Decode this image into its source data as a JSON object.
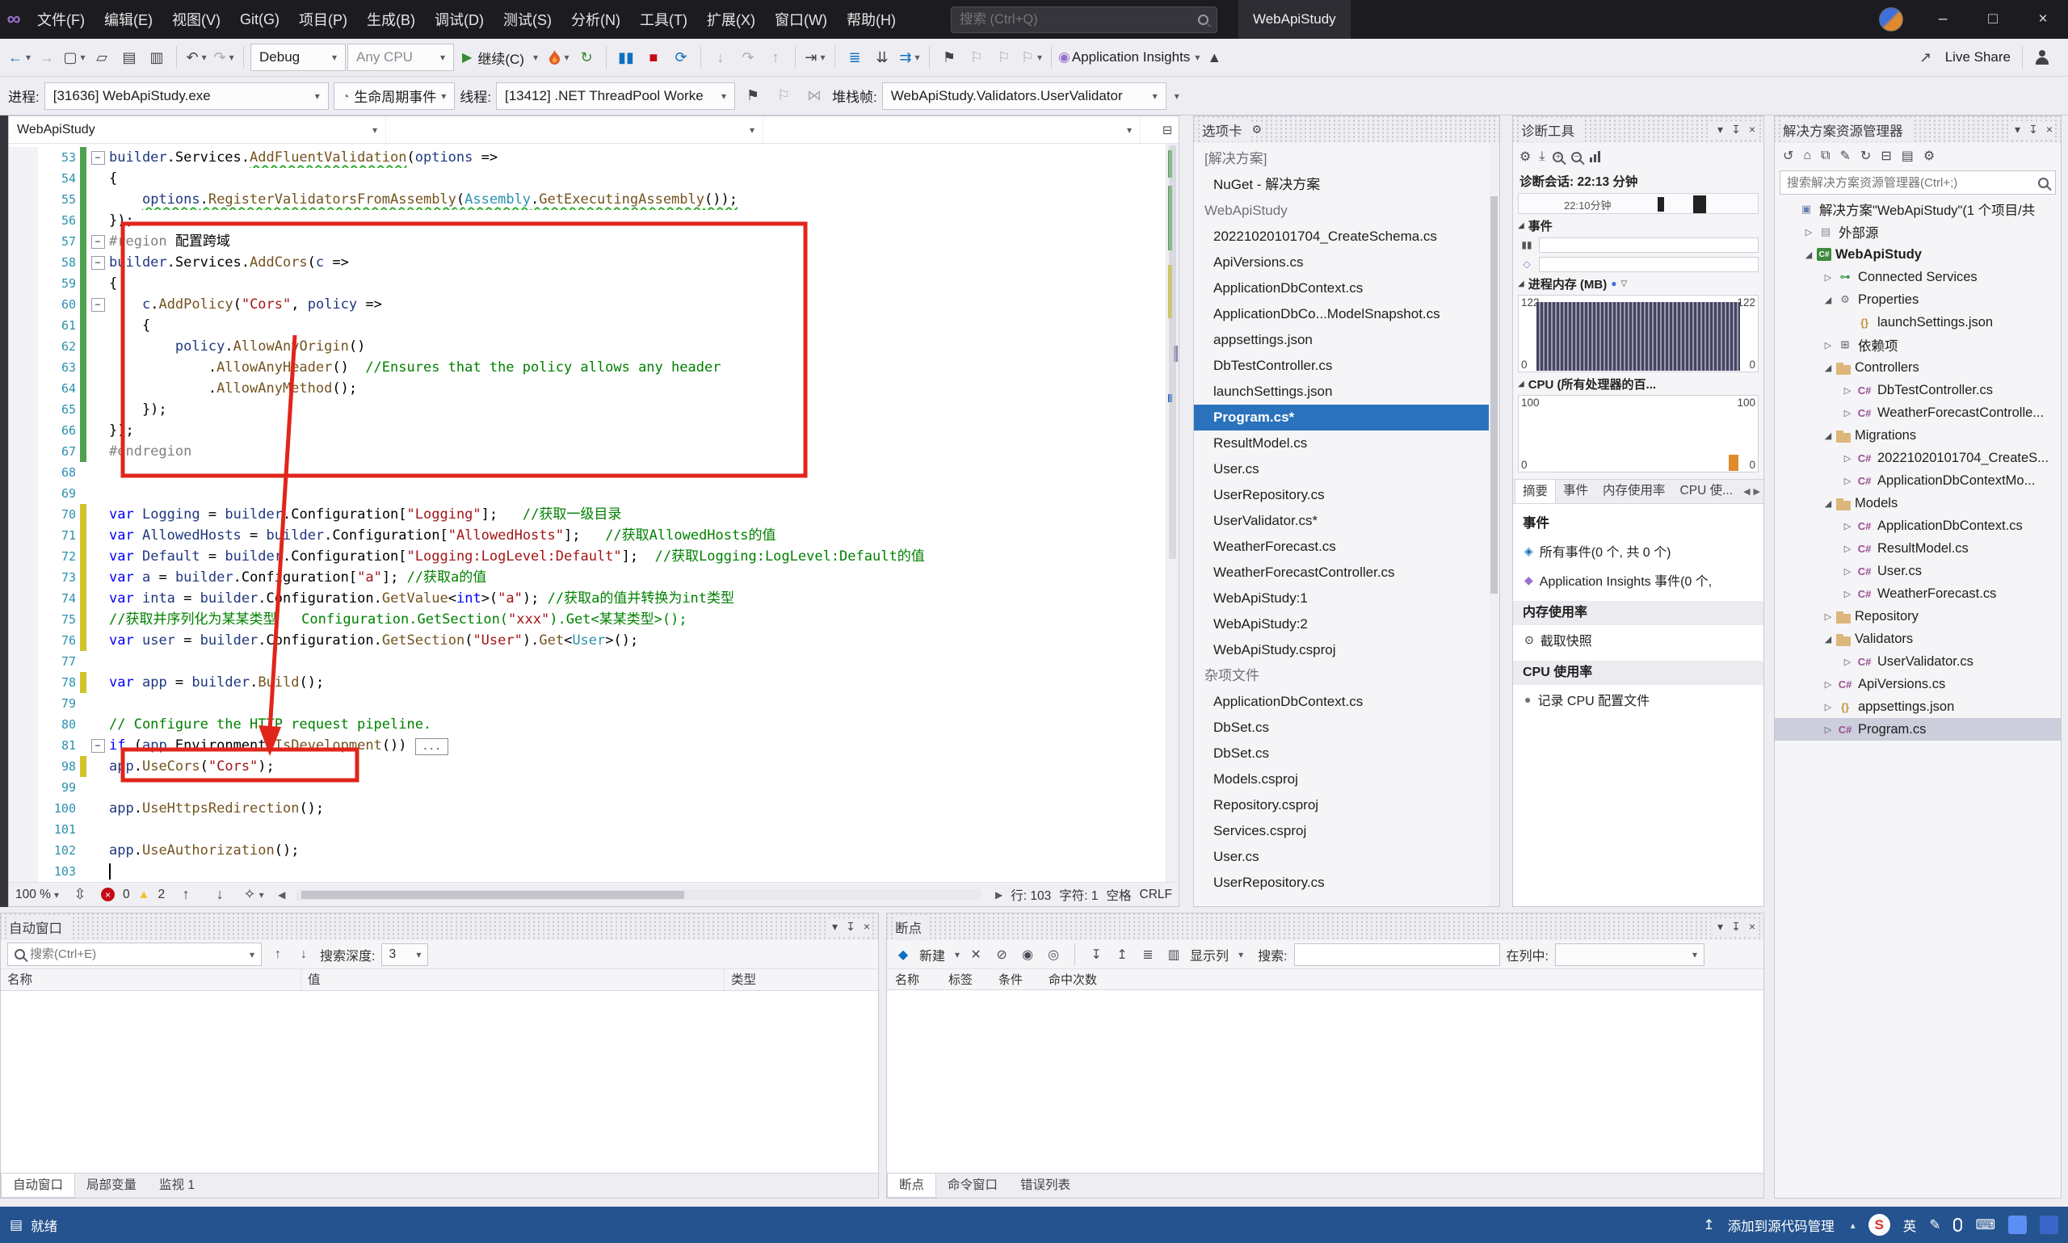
{
  "colors": {
    "accent_blue": "#2b72bd",
    "selection_gray": "#cccedb",
    "annotation_red": "#e1251b",
    "statusbar_blue": "#25538f",
    "error_red": "#c50b17",
    "warning_yellow": "#f2c233",
    "debug_green": "#388a34",
    "keyword_blue": "#0000ff",
    "string_red": "#a31515",
    "comment_green": "#008000",
    "type_teal": "#2b91af"
  },
  "titlebar": {
    "menus": [
      "文件(F)",
      "编辑(E)",
      "视图(V)",
      "Git(G)",
      "项目(P)",
      "生成(B)",
      "调试(D)",
      "测试(S)",
      "分析(N)",
      "工具(T)",
      "扩展(X)",
      "窗口(W)",
      "帮助(H)"
    ],
    "search_placeholder": "搜索 (Ctrl+Q)",
    "solution_name": "WebApiStudy"
  },
  "toolbar": {
    "debug_config": "Debug",
    "platform": "Any CPU",
    "continue_label": "继续(C)",
    "app_insights": "Application Insights",
    "live_share": "Live Share"
  },
  "debugbar": {
    "process_label": "进程:",
    "process": "[31636] WebApiStudy.exe",
    "lifecycle": "生命周期事件",
    "thread_label": "线程:",
    "thread": "[13412] .NET ThreadPool Worke",
    "stack_label": "堆栈帧:",
    "stack": "WebApiStudy.Validators.UserValidator"
  },
  "editor": {
    "breadcrumb": "WebApiStudy",
    "status": {
      "zoom": "100 %",
      "errors": "0",
      "warnings": "2",
      "line": "行: 103",
      "col": "字符: 1",
      "space": "空格",
      "eol": "CRLF"
    },
    "code": [
      {
        "n": 53,
        "fold": true,
        "chg": "g",
        "toks": [
          [
            "l",
            "builder"
          ],
          [
            "p",
            ".Services."
          ],
          [
            "m u",
            "AddFluentValidation"
          ],
          [
            "p",
            "("
          ],
          [
            "l",
            "options"
          ],
          [
            "p",
            " =>"
          ]
        ]
      },
      {
        "n": 54,
        "chg": "g",
        "toks": [
          [
            "p",
            "{"
          ]
        ]
      },
      {
        "n": 55,
        "chg": "g",
        "toks": [
          [
            "p",
            "    "
          ],
          [
            "l u",
            "options"
          ],
          [
            "p u",
            "."
          ],
          [
            "m u",
            "RegisterValidatorsFromAssembly"
          ],
          [
            "p u",
            "("
          ],
          [
            "t u",
            "Assembly"
          ],
          [
            "p u",
            "."
          ],
          [
            "m u",
            "GetExecutingAssembly"
          ],
          [
            "p u",
            "());"
          ]
        ]
      },
      {
        "n": 56,
        "chg": "g",
        "toks": [
          [
            "p",
            "});"
          ]
        ]
      },
      {
        "n": 57,
        "fold": true,
        "chg": "g",
        "toks": [
          [
            "pp",
            "#region"
          ],
          [
            "p",
            " 配置跨域"
          ]
        ]
      },
      {
        "n": 58,
        "fold": true,
        "chg": "g",
        "toks": [
          [
            "l",
            "builder"
          ],
          [
            "p",
            ".Services."
          ],
          [
            "m",
            "AddCors"
          ],
          [
            "p",
            "("
          ],
          [
            "l",
            "c"
          ],
          [
            "p",
            " =>"
          ]
        ]
      },
      {
        "n": 59,
        "chg": "g",
        "toks": [
          [
            "p",
            "{"
          ]
        ]
      },
      {
        "n": 60,
        "fold": true,
        "chg": "g",
        "toks": [
          [
            "p",
            "    "
          ],
          [
            "l",
            "c"
          ],
          [
            "p",
            "."
          ],
          [
            "m",
            "AddPolicy"
          ],
          [
            "p",
            "("
          ],
          [
            "s",
            "\"Cors\""
          ],
          [
            "p",
            ", "
          ],
          [
            "l",
            "policy"
          ],
          [
            "p",
            " =>"
          ]
        ]
      },
      {
        "n": 61,
        "chg": "g",
        "toks": [
          [
            "p",
            "    {"
          ]
        ]
      },
      {
        "n": 62,
        "chg": "g",
        "toks": [
          [
            "p",
            "        "
          ],
          [
            "l",
            "policy"
          ],
          [
            "p",
            "."
          ],
          [
            "m",
            "AllowAnyOrigin"
          ],
          [
            "p",
            "()"
          ]
        ]
      },
      {
        "n": 63,
        "chg": "g",
        "toks": [
          [
            "p",
            "            ."
          ],
          [
            "m",
            "AllowAnyHeader"
          ],
          [
            "p",
            "()  "
          ],
          [
            "c",
            "//Ensures that the policy allows any header"
          ]
        ]
      },
      {
        "n": 64,
        "chg": "g",
        "toks": [
          [
            "p",
            "            ."
          ],
          [
            "m",
            "AllowAnyMethod"
          ],
          [
            "p",
            "();"
          ]
        ]
      },
      {
        "n": 65,
        "chg": "g",
        "toks": [
          [
            "p",
            "    });"
          ]
        ]
      },
      {
        "n": 66,
        "chg": "g",
        "toks": [
          [
            "p",
            "});"
          ]
        ]
      },
      {
        "n": 67,
        "chg": "g",
        "toks": [
          [
            "pp",
            "#endregion"
          ]
        ]
      },
      {
        "n": 68,
        "toks": []
      },
      {
        "n": 69,
        "toks": []
      },
      {
        "n": 70,
        "chg": "y",
        "toks": [
          [
            "k",
            "var"
          ],
          [
            "p",
            " "
          ],
          [
            "l",
            "Logging"
          ],
          [
            "p",
            " = "
          ],
          [
            "l",
            "builder"
          ],
          [
            "p",
            ".Configuration["
          ],
          [
            "s",
            "\"Logging\""
          ],
          [
            "p",
            "];   "
          ],
          [
            "c",
            "//获取一级目录"
          ]
        ]
      },
      {
        "n": 71,
        "chg": "y",
        "toks": [
          [
            "k",
            "var"
          ],
          [
            "p",
            " "
          ],
          [
            "l",
            "AllowedHosts"
          ],
          [
            "p",
            " = "
          ],
          [
            "l",
            "builder"
          ],
          [
            "p",
            ".Configuration["
          ],
          [
            "s",
            "\"AllowedHosts\""
          ],
          [
            "p",
            "];   "
          ],
          [
            "c",
            "//获取AllowedHosts的值"
          ]
        ]
      },
      {
        "n": 72,
        "chg": "y",
        "toks": [
          [
            "k",
            "var"
          ],
          [
            "p",
            " "
          ],
          [
            "l",
            "Default"
          ],
          [
            "p",
            " = "
          ],
          [
            "l",
            "builder"
          ],
          [
            "p",
            ".Configuration["
          ],
          [
            "s",
            "\"Logging:LogLevel:Default\""
          ],
          [
            "p",
            "];  "
          ],
          [
            "c",
            "//获取Logging:LogLevel:Default的值"
          ]
        ]
      },
      {
        "n": 73,
        "chg": "y",
        "toks": [
          [
            "k",
            "var"
          ],
          [
            "p",
            " "
          ],
          [
            "l",
            "a"
          ],
          [
            "p",
            " = "
          ],
          [
            "l",
            "builder"
          ],
          [
            "p",
            ".Configuration["
          ],
          [
            "s",
            "\"a\""
          ],
          [
            "p",
            "]; "
          ],
          [
            "c",
            "//获取a的值"
          ]
        ]
      },
      {
        "n": 74,
        "chg": "y",
        "toks": [
          [
            "k",
            "var"
          ],
          [
            "p",
            " "
          ],
          [
            "l",
            "inta"
          ],
          [
            "p",
            " = "
          ],
          [
            "l",
            "builder"
          ],
          [
            "p",
            ".Configuration."
          ],
          [
            "m",
            "GetValue"
          ],
          [
            "p",
            "<"
          ],
          [
            "k",
            "int"
          ],
          [
            "p",
            ">("
          ],
          [
            "s",
            "\"a\""
          ],
          [
            "p",
            "); "
          ],
          [
            "c",
            "//获取a的值并转换为int类型"
          ]
        ]
      },
      {
        "n": 75,
        "chg": "y",
        "toks": [
          [
            "c",
            "//获取并序列化为某某类型   Configuration.GetSection("
          ],
          [
            "s",
            "\"xxx\""
          ],
          [
            "c",
            ").Get<某某类型>();"
          ]
        ]
      },
      {
        "n": 76,
        "chg": "y",
        "toks": [
          [
            "k",
            "var"
          ],
          [
            "p",
            " "
          ],
          [
            "l",
            "user"
          ],
          [
            "p",
            " = "
          ],
          [
            "l",
            "builder"
          ],
          [
            "p",
            ".Configuration."
          ],
          [
            "m",
            "GetSection"
          ],
          [
            "p",
            "("
          ],
          [
            "s",
            "\"User\""
          ],
          [
            "p",
            ")."
          ],
          [
            "m",
            "Get"
          ],
          [
            "p",
            "<"
          ],
          [
            "t",
            "User"
          ],
          [
            "p",
            ">();"
          ]
        ]
      },
      {
        "n": 77,
        "toks": []
      },
      {
        "n": 78,
        "chg": "y",
        "toks": [
          [
            "k",
            "var"
          ],
          [
            "p",
            " "
          ],
          [
            "l",
            "app"
          ],
          [
            "p",
            " = "
          ],
          [
            "l",
            "builder"
          ],
          [
            "p",
            "."
          ],
          [
            "m",
            "Build"
          ],
          [
            "p",
            "();"
          ]
        ]
      },
      {
        "n": 79,
        "toks": []
      },
      {
        "n": 80,
        "toks": [
          [
            "c",
            "// Configure the HTTP request pipeline."
          ]
        ]
      },
      {
        "n": 81,
        "fold": true,
        "collapsed": true,
        "toks": [
          [
            "k",
            "if"
          ],
          [
            "p",
            " ("
          ],
          [
            "l",
            "app"
          ],
          [
            "p",
            ".Environment."
          ],
          [
            "m",
            "IsDevelopment"
          ],
          [
            "p",
            "())"
          ]
        ]
      },
      {
        "n": 98,
        "chg": "y",
        "toks": [
          [
            "l",
            "app"
          ],
          [
            "p",
            "."
          ],
          [
            "m",
            "UseCors"
          ],
          [
            "p",
            "("
          ],
          [
            "s",
            "\"Cors\""
          ],
          [
            "p",
            ");"
          ]
        ]
      },
      {
        "n": 99,
        "toks": []
      },
      {
        "n": 100,
        "toks": [
          [
            "l",
            "app"
          ],
          [
            "p",
            "."
          ],
          [
            "m",
            "UseHttpsRedirection"
          ],
          [
            "p",
            "();"
          ]
        ]
      },
      {
        "n": 101,
        "toks": []
      },
      {
        "n": 102,
        "toks": [
          [
            "l",
            "app"
          ],
          [
            "p",
            "."
          ],
          [
            "m",
            "UseAuthorization"
          ],
          [
            "p",
            "();"
          ]
        ]
      },
      {
        "n": 103,
        "caret": true,
        "toks": []
      }
    ]
  },
  "tabs_panel": {
    "title": "选项卡",
    "items": [
      {
        "label": "[解决方案]",
        "type": "section"
      },
      {
        "label": "NuGet - 解决方案"
      },
      {
        "label": "WebApiStudy",
        "type": "section"
      },
      {
        "label": "20221020101704_CreateSchema.cs"
      },
      {
        "label": "ApiVersions.cs"
      },
      {
        "label": "ApplicationDbContext.cs"
      },
      {
        "label": "ApplicationDbCo...ModelSnapshot.cs"
      },
      {
        "label": "appsettings.json"
      },
      {
        "label": "DbTestController.cs"
      },
      {
        "label": "launchSettings.json"
      },
      {
        "label": "Program.cs*",
        "selected": true
      },
      {
        "label": "ResultModel.cs"
      },
      {
        "label": "User.cs"
      },
      {
        "label": "UserRepository.cs"
      },
      {
        "label": "UserValidator.cs*"
      },
      {
        "label": "WeatherForecast.cs"
      },
      {
        "label": "WeatherForecastController.cs"
      },
      {
        "label": "WebApiStudy:1"
      },
      {
        "label": "WebApiStudy:2"
      },
      {
        "label": "WebApiStudy.csproj"
      },
      {
        "label": "杂项文件",
        "type": "section"
      },
      {
        "label": "ApplicationDbContext.cs"
      },
      {
        "label": "DbSet.cs"
      },
      {
        "label": "DbSet.cs"
      },
      {
        "label": "Models.csproj"
      },
      {
        "label": "Repository.csproj"
      },
      {
        "label": "Services.csproj"
      },
      {
        "label": "User.cs"
      },
      {
        "label": "UserRepository.cs"
      }
    ]
  },
  "diag": {
    "title": "诊断工具",
    "session": "诊断会话: 22:13 分钟",
    "tick": "22:10分钟",
    "events_label": "事件",
    "memory_label": "进程内存 (MB)",
    "cpu_label": "CPU (所有处理器的百...",
    "mem_max": "122",
    "mem_min": "0",
    "cpu_max": "100",
    "cpu_min": "0",
    "tabs": [
      "摘要",
      "事件",
      "内存使用率",
      "CPU 使..."
    ],
    "summary": {
      "events_title": "事件",
      "all_events": "所有事件(0 个, 共 0 个)",
      "ai_events": "Application Insights 事件(0 个,",
      "memory_title": "内存使用率",
      "snapshot": "截取快照",
      "cpu_title": "CPU 使用率",
      "record": "记录 CPU 配置文件"
    }
  },
  "solution": {
    "title": "解决方案资源管理器",
    "search_placeholder": "搜索解决方案资源管理器(Ctrl+;)",
    "tree": [
      {
        "d": 0,
        "a": "",
        "i": "solution",
        "t": "解决方案\"WebApiStudy\"(1 个项目/共"
      },
      {
        "d": 1,
        "a": "c",
        "i": "ext",
        "t": "外部源"
      },
      {
        "d": 1,
        "a": "e",
        "i": "proj",
        "t": "WebApiStudy",
        "bold": true
      },
      {
        "d": 2,
        "a": "c",
        "i": "plug",
        "t": "Connected Services"
      },
      {
        "d": 2,
        "a": "e",
        "i": "wrench",
        "t": "Properties"
      },
      {
        "d": 3,
        "a": "",
        "i": "json",
        "t": "launchSettings.json"
      },
      {
        "d": 2,
        "a": "c",
        "i": "deps",
        "t": "依赖项"
      },
      {
        "d": 2,
        "a": "e",
        "i": "folder",
        "t": "Controllers"
      },
      {
        "d": 3,
        "a": "c",
        "i": "cs",
        "t": "DbTestController.cs"
      },
      {
        "d": 3,
        "a": "c",
        "i": "cs",
        "t": "WeatherForecastControlle..."
      },
      {
        "d": 2,
        "a": "e",
        "i": "folder",
        "t": "Migrations"
      },
      {
        "d": 3,
        "a": "c",
        "i": "cs",
        "t": "20221020101704_CreateS..."
      },
      {
        "d": 3,
        "a": "c",
        "i": "cs",
        "t": "ApplicationDbContextMo..."
      },
      {
        "d": 2,
        "a": "e",
        "i": "folder",
        "t": "Models"
      },
      {
        "d": 3,
        "a": "c",
        "i": "cs",
        "t": "ApplicationDbContext.cs"
      },
      {
        "d": 3,
        "a": "c",
        "i": "cs",
        "t": "ResultModel.cs"
      },
      {
        "d": 3,
        "a": "c",
        "i": "cs",
        "t": "User.cs"
      },
      {
        "d": 3,
        "a": "c",
        "i": "cs",
        "t": "WeatherForecast.cs"
      },
      {
        "d": 2,
        "a": "c",
        "i": "folder",
        "t": "Repository"
      },
      {
        "d": 2,
        "a": "e",
        "i": "folder",
        "t": "Validators"
      },
      {
        "d": 3,
        "a": "c",
        "i": "cs",
        "t": "UserValidator.cs"
      },
      {
        "d": 2,
        "a": "c",
        "i": "cs",
        "t": "ApiVersions.cs"
      },
      {
        "d": 2,
        "a": "c",
        "i": "json",
        "t": "appsettings.json"
      },
      {
        "d": 2,
        "a": "c",
        "i": "cs",
        "t": "Program.cs",
        "selected": true
      }
    ]
  },
  "autos": {
    "title": "自动窗口",
    "search_placeholder": "搜索(Ctrl+E)",
    "depth_label": "搜索深度:",
    "depth_value": "3",
    "columns": [
      "名称",
      "值",
      "类型"
    ],
    "tabs": [
      "自动窗口",
      "局部变量",
      "监视 1"
    ]
  },
  "breakpoints": {
    "title": "断点",
    "new_label": "新建",
    "show_columns": "显示列",
    "search_label": "搜索:",
    "in_column_label": "在列中:",
    "columns": [
      "名称",
      "标签",
      "条件",
      "命中次数"
    ],
    "tabs": [
      "断点",
      "命令窗口",
      "错误列表"
    ]
  },
  "statusbar": {
    "ready": "就绪",
    "source_control": "添加到源代码管理",
    "ime": "英"
  }
}
